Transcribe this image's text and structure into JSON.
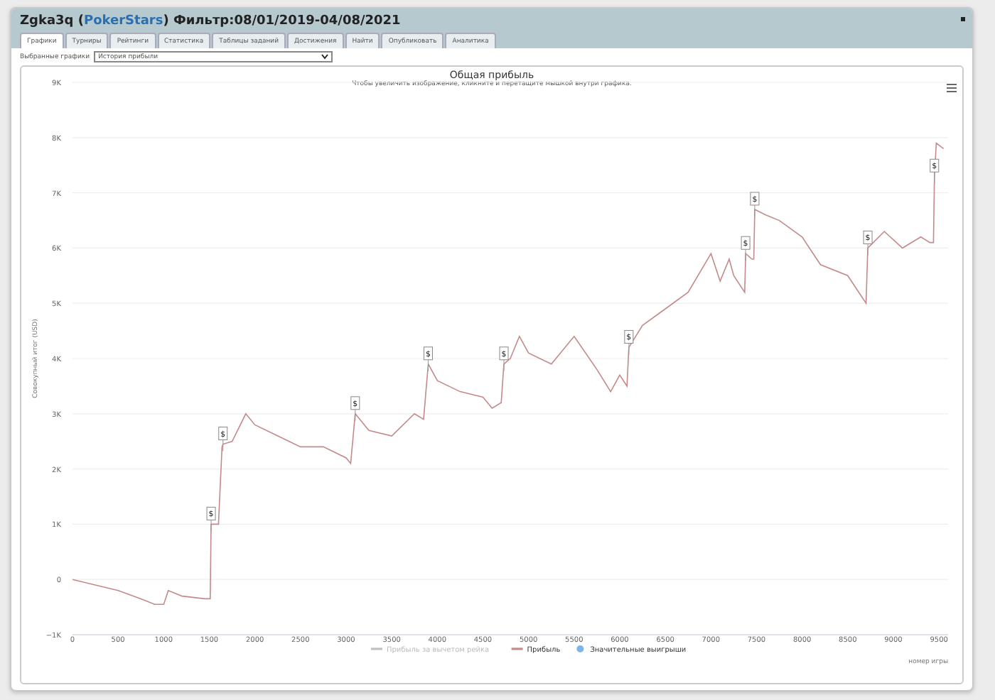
{
  "window": {
    "title_start": "Zgka3q (",
    "site": "PokerStars",
    "title_end": ") Фильтр:08/01/2019-04/08/2021"
  },
  "tabs": [
    {
      "label": "Графики",
      "selected": true
    },
    {
      "label": "Турниры",
      "selected": false
    },
    {
      "label": "Рейтинги",
      "selected": false
    },
    {
      "label": "Статистика",
      "selected": false
    },
    {
      "label": "Таблицы заданий",
      "selected": false
    },
    {
      "label": "Достижения",
      "selected": false
    },
    {
      "label": "Найти",
      "selected": false
    },
    {
      "label": "Опубликовать",
      "selected": false
    },
    {
      "label": "Аналитика",
      "selected": false
    }
  ],
  "graph_select": {
    "label": "Выбранные графики",
    "value": "История прибыли"
  },
  "chart": {
    "legend": [
      {
        "label": "Прибыль за вычетом рейка",
        "kind": "line",
        "visible": false
      },
      {
        "label": "Значительные выигрыши",
        "kind": "dot",
        "visible": true,
        "color": "#7cb5ec"
      }
    ],
    "chart_data": {
      "type": "line",
      "title": "Общая прибыль",
      "subtitle": "Чтобы увеличить изображение, кликните и перетащите мышкой внутри графика.",
      "xlabel": "номер игры",
      "ylabel": "Совокупный итог (USD)",
      "x": [
        0,
        250,
        500,
        750,
        900,
        1000,
        1050,
        1200,
        1450,
        1510,
        1520,
        1600,
        1640,
        1650,
        1750,
        1900,
        2000,
        2250,
        2500,
        2750,
        3000,
        3050,
        3100,
        3250,
        3500,
        3750,
        3850,
        3900,
        4000,
        4250,
        4500,
        4600,
        4700,
        4730,
        4800,
        4900,
        5000,
        5250,
        5500,
        5750,
        5900,
        6000,
        6080,
        6100,
        6250,
        6500,
        6750,
        7000,
        7100,
        7200,
        7250,
        7370,
        7380,
        7450,
        7470,
        7480,
        7600,
        7750,
        8000,
        8200,
        8500,
        8700,
        8720,
        8900,
        9100,
        9300,
        9400,
        9440,
        9450,
        9470,
        9550
      ],
      "series": [
        {
          "name": "Прибыль",
          "color": "#c48a8a",
          "values": [
            0,
            -100,
            -200,
            -350,
            -450,
            -450,
            -200,
            -300,
            -350,
            -350,
            1000,
            1000,
            2400,
            2450,
            2500,
            3000,
            2800,
            2600,
            2400,
            2400,
            2200,
            2100,
            3000,
            2700,
            2600,
            3000,
            2900,
            3900,
            3600,
            3400,
            3300,
            3100,
            3200,
            3900,
            4000,
            4400,
            4100,
            3900,
            4400,
            3800,
            3400,
            3700,
            3500,
            4200,
            4600,
            4900,
            5200,
            5900,
            5400,
            5800,
            5500,
            5200,
            5900,
            5800,
            5800,
            6700,
            6600,
            6500,
            6200,
            5700,
            5500,
            5000,
            6000,
            6300,
            6000,
            6200,
            6100,
            6100,
            7300,
            7900,
            7800
          ]
        }
      ],
      "annotations": [
        {
          "x": 1520,
          "text": "$"
        },
        {
          "x": 1650,
          "text": "$"
        },
        {
          "x": 3100,
          "text": "$"
        },
        {
          "x": 3900,
          "text": "$"
        },
        {
          "x": 4730,
          "text": "$"
        },
        {
          "x": 6100,
          "text": "$"
        },
        {
          "x": 7380,
          "text": "$"
        },
        {
          "x": 7480,
          "text": "$"
        },
        {
          "x": 8720,
          "text": "$"
        },
        {
          "x": 9450,
          "text": "$"
        }
      ],
      "grid": true,
      "xlim": [
        0,
        9600
      ],
      "ylim": [
        -1000,
        9000
      ],
      "xticks": [
        0,
        500,
        1000,
        1500,
        2000,
        2500,
        3000,
        3500,
        4000,
        4500,
        5000,
        5500,
        6000,
        6500,
        7000,
        7500,
        8000,
        8500,
        9000,
        9500
      ],
      "yticks": [
        {
          "value": -1000,
          "label": "−1K"
        },
        {
          "value": 0,
          "label": "0"
        },
        {
          "value": 1000,
          "label": "1K"
        },
        {
          "value": 2000,
          "label": "2K"
        },
        {
          "value": 3000,
          "label": "3K"
        },
        {
          "value": 4000,
          "label": "4K"
        },
        {
          "value": 5000,
          "label": "5K"
        },
        {
          "value": 6000,
          "label": "6K"
        },
        {
          "value": 7000,
          "label": "7K"
        },
        {
          "value": 8000,
          "label": "8K"
        },
        {
          "value": 9000,
          "label": "9K"
        }
      ]
    }
  }
}
